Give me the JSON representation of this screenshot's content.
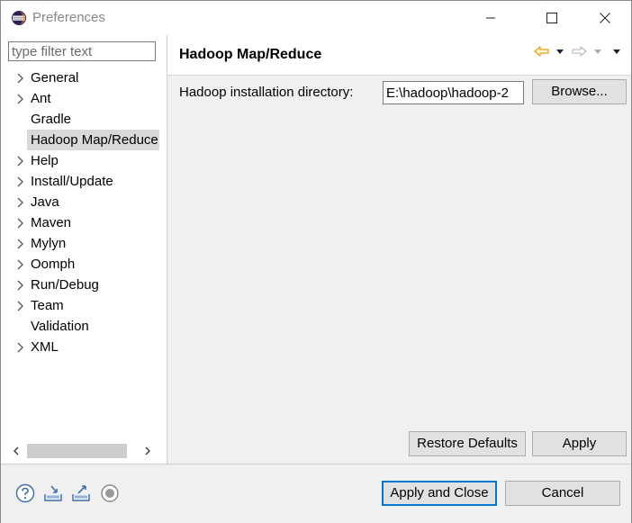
{
  "window": {
    "title": "Preferences"
  },
  "filter": {
    "placeholder": "type filter text"
  },
  "tree": [
    {
      "label": "General",
      "expandable": true,
      "selected": false
    },
    {
      "label": "Ant",
      "expandable": true,
      "selected": false
    },
    {
      "label": "Gradle",
      "expandable": false,
      "selected": false
    },
    {
      "label": "Hadoop Map/Reduce",
      "expandable": false,
      "selected": true
    },
    {
      "label": "Help",
      "expandable": true,
      "selected": false
    },
    {
      "label": "Install/Update",
      "expandable": true,
      "selected": false
    },
    {
      "label": "Java",
      "expandable": true,
      "selected": false
    },
    {
      "label": "Maven",
      "expandable": true,
      "selected": false
    },
    {
      "label": "Mylyn",
      "expandable": true,
      "selected": false
    },
    {
      "label": "Oomph",
      "expandable": true,
      "selected": false
    },
    {
      "label": "Run/Debug",
      "expandable": true,
      "selected": false
    },
    {
      "label": "Team",
      "expandable": true,
      "selected": false
    },
    {
      "label": "Validation",
      "expandable": false,
      "selected": false
    },
    {
      "label": "XML",
      "expandable": true,
      "selected": false
    }
  ],
  "page": {
    "title": "Hadoop Map/Reduce",
    "field_label": "Hadoop installation directory:",
    "field_value": "E:\\hadoop\\hadoop-2",
    "browse_label": "Browse...",
    "restore_label": "Restore Defaults",
    "apply_label": "Apply"
  },
  "footer": {
    "apply_close_label": "Apply and Close",
    "cancel_label": "Cancel"
  },
  "colors": {
    "accent": "#0078d7",
    "back_arrow": "#e8a317",
    "selection": "#d9d9d9"
  },
  "icons": [
    "eclipse-icon",
    "minimize-icon",
    "maximize-icon",
    "close-icon",
    "back-arrow-icon",
    "forward-arrow-icon",
    "help-icon",
    "import-icon",
    "export-icon",
    "record-icon"
  ]
}
